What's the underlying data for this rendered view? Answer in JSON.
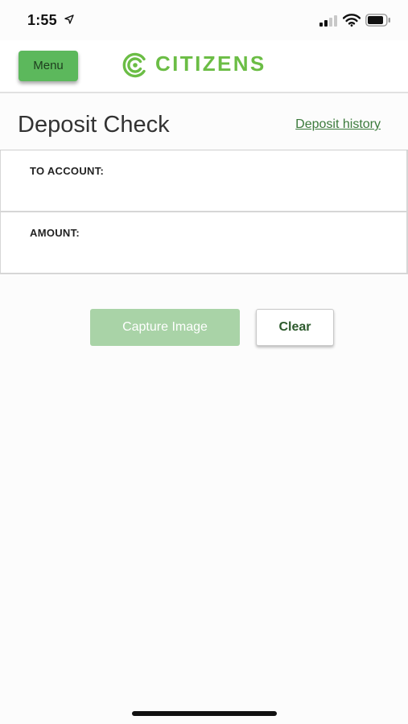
{
  "status_bar": {
    "time": "1:55",
    "icons": [
      "location-arrow-icon",
      "cellular-signal-icon",
      "wifi-icon",
      "battery-icon"
    ]
  },
  "header": {
    "menu_label": "Menu",
    "brand_name": "CITIZENS",
    "logo_icon": "citizens-logo-icon"
  },
  "page": {
    "title": "Deposit Check",
    "history_link": "Deposit history"
  },
  "form": {
    "fields": [
      {
        "label": "TO ACCOUNT:",
        "value": ""
      },
      {
        "label": "AMOUNT:",
        "value": ""
      }
    ]
  },
  "actions": {
    "capture_label": "Capture Image",
    "clear_label": "Clear"
  },
  "colors": {
    "brand_green": "#6bbd45",
    "menu_green": "#5cb85c",
    "capture_disabled": "#a9d3a7",
    "link_green": "#3b7a3b"
  }
}
